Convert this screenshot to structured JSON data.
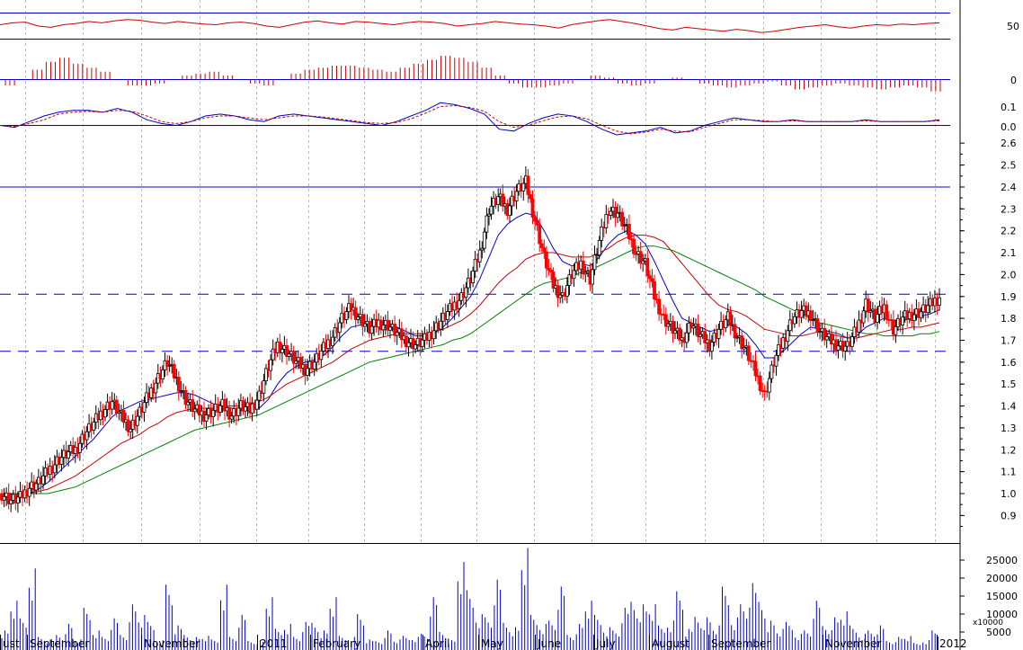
{
  "chart_data": [
    {
      "type": "line",
      "panel": "oscillator",
      "yticks": [
        "50"
      ],
      "series": [
        {
          "values": [
            52,
            55,
            56,
            50,
            48,
            52,
            54,
            57,
            55,
            58,
            60,
            59,
            56,
            54,
            57,
            55,
            53,
            52,
            55,
            56,
            54,
            50,
            48,
            52,
            56,
            58,
            55,
            53,
            57,
            56,
            54,
            52,
            55,
            57,
            56,
            54,
            50,
            52,
            54,
            57,
            55,
            53,
            52,
            50,
            47,
            52,
            55,
            58,
            60,
            57,
            54,
            50,
            46,
            44,
            48,
            46,
            44,
            42,
            45,
            43,
            40,
            42,
            45,
            48,
            50,
            52,
            49,
            47,
            50,
            52,
            51,
            53,
            52,
            54,
            55
          ]
        }
      ],
      "reference_levels": [
        70,
        30
      ],
      "color": "#cc0000"
    },
    {
      "type": "bar",
      "panel": "histogram",
      "yticks": [
        "0"
      ],
      "values": [
        -0.03,
        0.0,
        0.05,
        0.09,
        0.11,
        0.08,
        0.06,
        0.04,
        0.0,
        -0.03,
        -0.03,
        -0.02,
        0.0,
        0.02,
        0.03,
        0.04,
        0.02,
        0.0,
        -0.02,
        -0.03,
        0.0,
        0.03,
        0.05,
        0.06,
        0.07,
        0.07,
        0.06,
        0.05,
        0.04,
        0.06,
        0.08,
        0.1,
        0.12,
        0.11,
        0.09,
        0.06,
        0.02,
        -0.02,
        -0.04,
        -0.04,
        -0.03,
        -0.02,
        0.0,
        0.02,
        0.01,
        -0.02,
        -0.03,
        -0.02,
        0.0,
        0.01,
        0.0,
        -0.02,
        -0.03,
        -0.04,
        -0.03,
        -0.02,
        -0.01,
        -0.03,
        -0.05,
        -0.04,
        -0.03,
        -0.02,
        -0.03,
        -0.04,
        -0.05,
        -0.04,
        -0.03,
        -0.04,
        -0.06
      ],
      "colors": {
        "positive": "#cc0000",
        "negative": "#cc0000"
      }
    },
    {
      "type": "line",
      "panel": "macd",
      "yticks": [
        "0.1",
        "0.0"
      ],
      "ylim": [
        -0.08,
        0.16
      ],
      "series": [
        {
          "color": "#0000cc",
          "values": [
            0.0,
            -0.01,
            0.02,
            0.05,
            0.07,
            0.08,
            0.08,
            0.07,
            0.09,
            0.07,
            0.03,
            0.01,
            0.0,
            0.02,
            0.05,
            0.06,
            0.05,
            0.03,
            0.02,
            0.05,
            0.06,
            0.05,
            0.04,
            0.03,
            0.02,
            0.01,
            0.0,
            0.02,
            0.05,
            0.08,
            0.12,
            0.11,
            0.09,
            0.06,
            -0.02,
            -0.03,
            0.01,
            0.04,
            0.06,
            0.05,
            0.02,
            -0.02,
            -0.05,
            -0.04,
            -0.03,
            -0.01,
            -0.04,
            -0.03,
            0.0,
            0.02,
            0.04,
            0.03,
            0.02,
            0.02,
            0.03,
            0.02,
            0.02,
            0.02,
            0.02,
            0.03,
            0.02,
            0.02,
            0.02,
            0.02,
            0.03
          ]
        },
        {
          "color": "#cc0000",
          "values": [
            0.0,
            -0.005,
            0.01,
            0.03,
            0.06,
            0.07,
            0.075,
            0.07,
            0.08,
            0.075,
            0.05,
            0.02,
            0.01,
            0.02,
            0.04,
            0.05,
            0.05,
            0.04,
            0.03,
            0.04,
            0.05,
            0.05,
            0.045,
            0.035,
            0.025,
            0.015,
            0.01,
            0.015,
            0.035,
            0.065,
            0.1,
            0.105,
            0.095,
            0.075,
            0.02,
            -0.01,
            0.0,
            0.025,
            0.045,
            0.05,
            0.035,
            0.0,
            -0.03,
            -0.045,
            -0.035,
            -0.02,
            -0.03,
            -0.035,
            -0.01,
            0.01,
            0.03,
            0.03,
            0.025,
            0.02,
            0.025,
            0.02,
            0.02,
            0.02,
            0.02,
            0.025,
            0.02,
            0.02,
            0.02,
            0.02,
            0.025
          ]
        }
      ]
    },
    {
      "type": "candlestick",
      "panel": "price",
      "ylim": [
        0.85,
        2.7
      ],
      "yticks": [
        "2.6",
        "2.5",
        "2.4",
        "2.3",
        "2.2",
        "2.1",
        "2.0",
        "1.9",
        "1.8",
        "1.7",
        "1.6",
        "1.5",
        "1.4",
        "1.3",
        "1.2",
        "1.1",
        "1.0",
        "0.9"
      ],
      "xticks": [
        "ust",
        "September",
        "November",
        "2011",
        "February",
        "April",
        "May",
        "June",
        "July",
        "August",
        "September",
        "November",
        "2012"
      ],
      "horizontal_lines": [
        {
          "y": 2.4,
          "style": "solid"
        },
        {
          "y": 1.91,
          "style": "dashed"
        },
        {
          "y": 1.65,
          "style": "dashed"
        }
      ],
      "close": [
        1.0,
        0.97,
        0.98,
        1.03,
        1.05,
        1.1,
        1.15,
        1.18,
        1.2,
        1.27,
        1.32,
        1.38,
        1.42,
        1.35,
        1.3,
        1.37,
        1.45,
        1.53,
        1.6,
        1.52,
        1.43,
        1.38,
        1.36,
        1.38,
        1.4,
        1.36,
        1.4,
        1.38,
        1.45,
        1.58,
        1.68,
        1.65,
        1.6,
        1.57,
        1.6,
        1.66,
        1.72,
        1.8,
        1.85,
        1.8,
        1.75,
        1.78,
        1.77,
        1.73,
        1.7,
        1.68,
        1.7,
        1.75,
        1.8,
        1.85,
        1.9,
        1.98,
        2.1,
        2.3,
        2.35,
        2.3,
        2.38,
        2.42,
        2.25,
        2.08,
        1.95,
        1.9,
        2.0,
        2.05,
        1.98,
        2.15,
        2.3,
        2.28,
        2.2,
        2.1,
        2.05,
        1.9,
        1.8,
        1.75,
        1.7,
        1.78,
        1.72,
        1.68,
        1.75,
        1.8,
        1.72,
        1.65,
        1.55,
        1.45,
        1.6,
        1.7,
        1.8,
        1.83,
        1.82,
        1.74,
        1.7,
        1.68,
        1.67,
        1.75,
        1.87,
        1.8,
        1.85,
        1.75,
        1.8,
        1.82,
        1.83,
        1.86,
        1.9
      ],
      "series": [
        {
          "color": "#0000cc",
          "values": [
            1.0,
            1.0,
            0.99,
            1.0,
            1.02,
            1.05,
            1.09,
            1.13,
            1.17,
            1.21,
            1.25,
            1.3,
            1.35,
            1.38,
            1.4,
            1.42,
            1.43,
            1.44,
            1.45,
            1.46,
            1.46,
            1.45,
            1.43,
            1.41,
            1.4,
            1.39,
            1.38,
            1.38,
            1.39,
            1.43,
            1.5,
            1.55,
            1.58,
            1.6,
            1.61,
            1.63,
            1.67,
            1.72,
            1.76,
            1.77,
            1.78,
            1.78,
            1.78,
            1.76,
            1.74,
            1.72,
            1.72,
            1.73,
            1.76,
            1.8,
            1.85,
            1.9,
            1.98,
            2.08,
            2.18,
            2.23,
            2.26,
            2.28,
            2.27,
            2.2,
            2.12,
            2.06,
            2.04,
            2.05,
            2.04,
            2.08,
            2.14,
            2.18,
            2.2,
            2.18,
            2.14,
            2.06,
            1.97,
            1.88,
            1.8,
            1.78,
            1.76,
            1.74,
            1.75,
            1.77,
            1.76,
            1.73,
            1.68,
            1.62,
            1.62,
            1.65,
            1.69,
            1.73,
            1.76,
            1.75,
            1.74,
            1.73,
            1.71,
            1.72,
            1.76,
            1.78,
            1.8,
            1.79,
            1.79,
            1.8,
            1.81,
            1.82,
            1.84
          ]
        },
        {
          "color": "#cc0000",
          "values": [
            1.0,
            1.0,
            1.0,
            1.0,
            1.01,
            1.02,
            1.04,
            1.06,
            1.08,
            1.11,
            1.14,
            1.17,
            1.2,
            1.23,
            1.25,
            1.27,
            1.3,
            1.32,
            1.35,
            1.37,
            1.38,
            1.39,
            1.39,
            1.39,
            1.4,
            1.4,
            1.4,
            1.41,
            1.42,
            1.44,
            1.47,
            1.5,
            1.52,
            1.54,
            1.56,
            1.58,
            1.6,
            1.63,
            1.66,
            1.68,
            1.7,
            1.71,
            1.72,
            1.73,
            1.73,
            1.73,
            1.73,
            1.74,
            1.75,
            1.77,
            1.79,
            1.82,
            1.86,
            1.91,
            1.96,
            2.0,
            2.03,
            2.07,
            2.09,
            2.1,
            2.1,
            2.09,
            2.08,
            2.08,
            2.08,
            2.1,
            2.12,
            2.15,
            2.17,
            2.18,
            2.18,
            2.17,
            2.15,
            2.1,
            2.05,
            2.0,
            1.95,
            1.9,
            1.86,
            1.84,
            1.83,
            1.81,
            1.78,
            1.75,
            1.74,
            1.73,
            1.72,
            1.72,
            1.73,
            1.74,
            1.73,
            1.72,
            1.71,
            1.71,
            1.72,
            1.73,
            1.74,
            1.75,
            1.75,
            1.76,
            1.76,
            1.77,
            1.78
          ]
        },
        {
          "color": "#008000",
          "values": [
            1.0,
            1.0,
            1.0,
            1.0,
            1.0,
            1.0,
            1.01,
            1.02,
            1.03,
            1.05,
            1.07,
            1.09,
            1.11,
            1.13,
            1.15,
            1.17,
            1.19,
            1.21,
            1.23,
            1.25,
            1.27,
            1.29,
            1.3,
            1.31,
            1.32,
            1.33,
            1.34,
            1.35,
            1.36,
            1.38,
            1.4,
            1.42,
            1.44,
            1.46,
            1.48,
            1.5,
            1.52,
            1.54,
            1.56,
            1.58,
            1.6,
            1.61,
            1.62,
            1.63,
            1.64,
            1.65,
            1.66,
            1.67,
            1.68,
            1.7,
            1.71,
            1.73,
            1.76,
            1.79,
            1.82,
            1.85,
            1.88,
            1.91,
            1.94,
            1.96,
            1.97,
            1.98,
            1.99,
            2.01,
            2.02,
            2.04,
            2.06,
            2.08,
            2.1,
            2.12,
            2.13,
            2.13,
            2.12,
            2.11,
            2.09,
            2.07,
            2.05,
            2.03,
            2.01,
            1.99,
            1.97,
            1.95,
            1.93,
            1.9,
            1.88,
            1.86,
            1.84,
            1.82,
            1.8,
            1.78,
            1.77,
            1.76,
            1.75,
            1.74,
            1.73,
            1.73,
            1.72,
            1.72,
            1.72,
            1.72,
            1.73,
            1.73,
            1.74
          ]
        }
      ],
      "colors": {
        "up": "#000000",
        "down": "#ff0000"
      }
    },
    {
      "type": "bar",
      "panel": "volume",
      "ylim": [
        0,
        30000
      ],
      "yticks": [
        "25000",
        "20000",
        "15000",
        "10000",
        "5000"
      ],
      "multiplier_label": "x10000",
      "color": "#0000cc",
      "values": [
        6000,
        14000,
        9000,
        25000,
        4000,
        3000,
        5000,
        8000,
        3000,
        12000,
        6000,
        4000,
        9000,
        5000,
        14000,
        10000,
        8000,
        3000,
        20000,
        7000,
        5000,
        4000,
        4000,
        3000,
        20000,
        4000,
        10000,
        3000,
        3000,
        15000,
        6000,
        8000,
        4000,
        8000,
        9000,
        6000,
        15000,
        4000,
        4000,
        11000,
        3000,
        3000,
        6000,
        3000,
        4000,
        4000,
        5000,
        15000,
        6000,
        3000,
        25000,
        17000,
        11000,
        10000,
        20000,
        9000,
        7000,
        29000,
        10000,
        8000,
        9000,
        18000,
        5000,
        8000,
        14000,
        10000,
        7000,
        6000,
        12000,
        16000,
        14000,
        13000,
        7000,
        9000,
        18000,
        6000,
        11000,
        10000,
        7000,
        18000,
        10000,
        14000,
        19000,
        16000,
        9000,
        6000,
        8000,
        5000,
        6000,
        14000,
        8000,
        10000,
        11000,
        7000,
        5000,
        6000,
        7000,
        3000,
        4000,
        4000,
        2000,
        3000,
        6000
      ]
    }
  ]
}
